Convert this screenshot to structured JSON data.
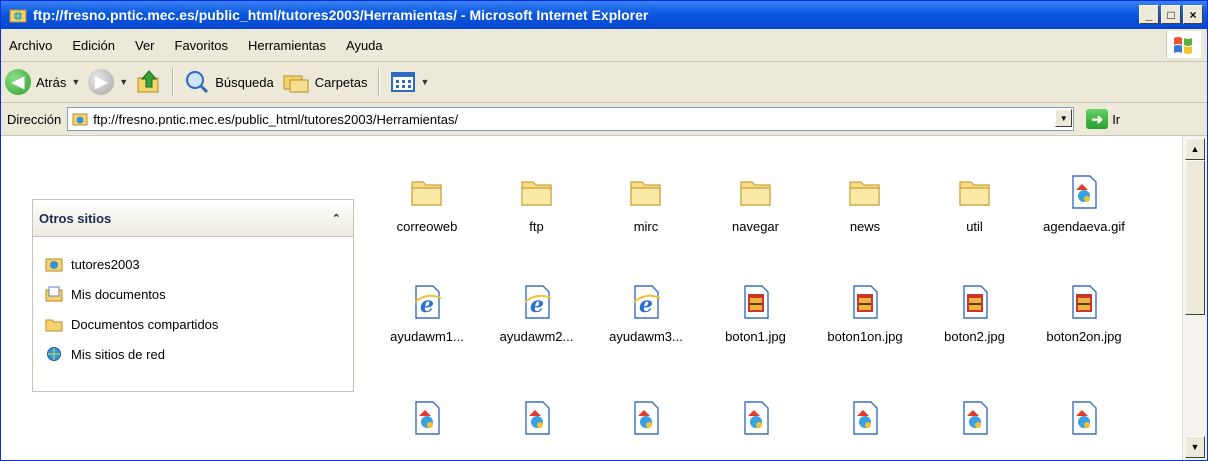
{
  "window": {
    "title": "ftp://fresno.pntic.mec.es/public_html/tutores2003/Herramientas/ - Microsoft Internet Explorer",
    "minimize": "_",
    "maximize": "□",
    "close": "×"
  },
  "menubar": {
    "items": [
      "Archivo",
      "Edición",
      "Ver",
      "Favoritos",
      "Herramientas",
      "Ayuda"
    ]
  },
  "toolbar": {
    "back_label": "Atrás",
    "search_label": "Búsqueda",
    "folders_label": "Carpetas"
  },
  "address": {
    "label": "Dirección",
    "value": "ftp://fresno.pntic.mec.es/public_html/tutores2003/Herramientas/",
    "go_label": "Ir"
  },
  "taskpane": {
    "section_title": "Otros sitios",
    "links": [
      {
        "label": "tutores2003",
        "icon": "ftp-folder-icon"
      },
      {
        "label": "Mis documentos",
        "icon": "documents-folder-icon"
      },
      {
        "label": "Documentos compartidos",
        "icon": "folder-icon"
      },
      {
        "label": "Mis sitios de red",
        "icon": "network-places-icon"
      }
    ]
  },
  "files": [
    {
      "name": "correoweb",
      "icon": "folder-icon"
    },
    {
      "name": "ftp",
      "icon": "folder-icon"
    },
    {
      "name": "mirc",
      "icon": "folder-icon"
    },
    {
      "name": "navegar",
      "icon": "folder-icon"
    },
    {
      "name": "news",
      "icon": "folder-icon"
    },
    {
      "name": "util",
      "icon": "folder-icon"
    },
    {
      "name": "agendaeva.gif",
      "icon": "image-file-icon"
    },
    {
      "name": "ayudawm1...",
      "icon": "ie-html-file-icon"
    },
    {
      "name": "ayudawm2...",
      "icon": "ie-html-file-icon"
    },
    {
      "name": "ayudawm3...",
      "icon": "ie-html-file-icon"
    },
    {
      "name": "boton1.jpg",
      "icon": "jpg-file-icon"
    },
    {
      "name": "boton1on.jpg",
      "icon": "jpg-file-icon"
    },
    {
      "name": "boton2.jpg",
      "icon": "jpg-file-icon"
    },
    {
      "name": "boton2on.jpg",
      "icon": "jpg-file-icon"
    },
    {
      "name": "",
      "icon": "image-file-icon"
    },
    {
      "name": "",
      "icon": "image-file-icon"
    },
    {
      "name": "",
      "icon": "image-file-icon"
    },
    {
      "name": "",
      "icon": "image-file-icon"
    },
    {
      "name": "",
      "icon": "image-file-icon"
    },
    {
      "name": "",
      "icon": "image-file-icon"
    },
    {
      "name": "",
      "icon": "image-file-icon"
    }
  ],
  "colors": {
    "titlebar": "#0a58e0",
    "chrome": "#ece9d8",
    "panel_title": "#1c2a57"
  }
}
